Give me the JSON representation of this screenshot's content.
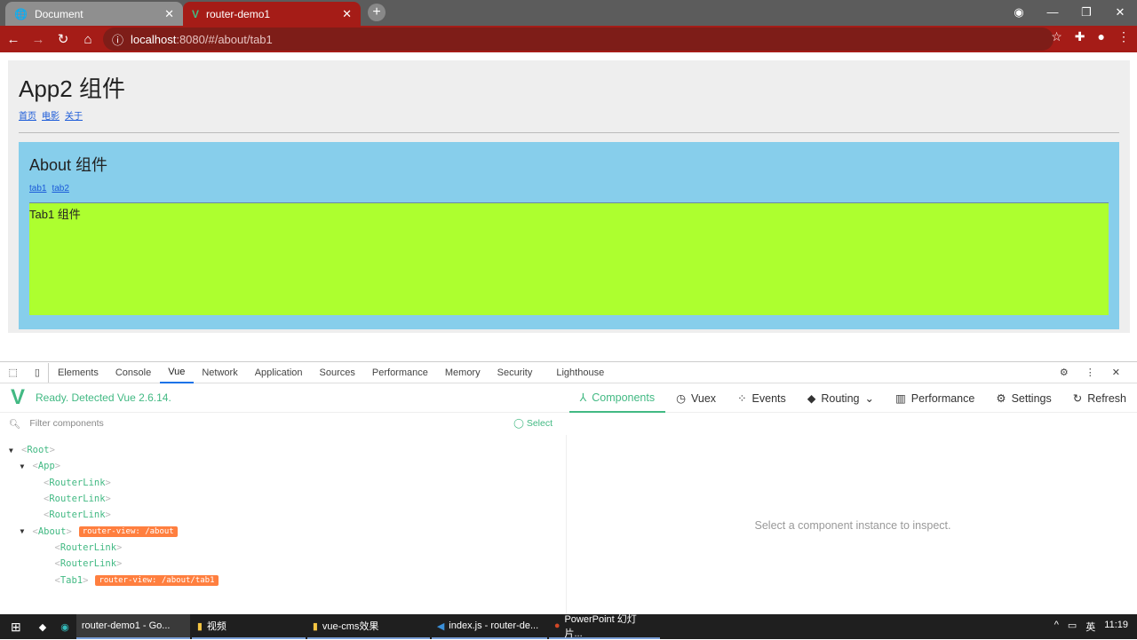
{
  "browser": {
    "tabs": [
      {
        "title": "Document",
        "icon": "globe-icon"
      },
      {
        "title": "router-demo1",
        "icon": "vue-logo-icon"
      }
    ],
    "url_host": "localhost",
    "url_path": ":8080/#/about/tab1"
  },
  "page": {
    "title": "App2 组件",
    "links": [
      "首页",
      "电影",
      "关于"
    ],
    "about": {
      "title": "About 组件",
      "links": [
        "tab1",
        "tab2"
      ],
      "tab1_text": "Tab1 组件"
    }
  },
  "devtools": {
    "tabs": [
      "Elements",
      "Console",
      "Vue",
      "Network",
      "Application",
      "Sources",
      "Performance",
      "Memory",
      "Security",
      "Lighthouse"
    ],
    "active_tab": "Vue",
    "status": "Ready. Detected Vue 2.6.14.",
    "nav": [
      "Components",
      "Vuex",
      "Events",
      "Routing",
      "Performance",
      "Settings",
      "Refresh"
    ],
    "filter_placeholder": "Filter components",
    "select_label": "Select",
    "tree": [
      {
        "name": "Root",
        "depth": 0,
        "arrow": "▼"
      },
      {
        "name": "App",
        "depth": 1,
        "arrow": "▼"
      },
      {
        "name": "RouterLink",
        "depth": 2
      },
      {
        "name": "RouterLink",
        "depth": 2
      },
      {
        "name": "RouterLink",
        "depth": 2
      },
      {
        "name": "About",
        "depth": 1,
        "arrow": "▼",
        "badge": "router-view: /about"
      },
      {
        "name": "RouterLink",
        "depth": 3
      },
      {
        "name": "RouterLink",
        "depth": 3
      },
      {
        "name": "Tab1",
        "depth": 3,
        "badge": "router-view: /about/tab1"
      }
    ],
    "empty_text": "Select a component instance to inspect."
  },
  "taskbar": {
    "items": [
      "router-demo1 - Go...",
      "视频",
      "vue-cms效果",
      "index.js - router-de...",
      "PowerPoint 幻灯片..."
    ],
    "ime": "英",
    "time": "11:19"
  },
  "colors": {
    "chrome": "#a51c17",
    "vue": "#42b983",
    "about_bg": "#87ceeb",
    "tab1_bg": "#adff2f",
    "badge": "#ff7f3f"
  }
}
